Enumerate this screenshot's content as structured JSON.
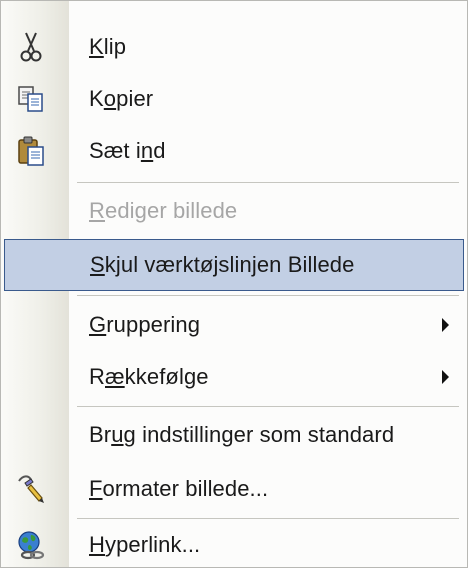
{
  "menu": {
    "items": [
      {
        "pre": "",
        "key": "K",
        "post": "lip",
        "icon": "scissors-icon"
      },
      {
        "pre": "K",
        "key": "o",
        "post": "pier",
        "icon": "copy-icon"
      },
      {
        "pre": "Sæt i",
        "key": "n",
        "post": "d",
        "icon": "clipboard-paste-icon"
      },
      {
        "pre": "",
        "key": "R",
        "post": "ediger billede",
        "disabled": true
      },
      {
        "pre": "",
        "key": "S",
        "post": "kjul værktøjslinjen Billede",
        "highlighted": true
      },
      {
        "pre": "",
        "key": "G",
        "post": "ruppering",
        "submenu": true
      },
      {
        "pre": "R",
        "key": "æ",
        "post": "kkefølge",
        "submenu": true
      },
      {
        "pre": "Br",
        "key": "u",
        "post": "g indstillinger som standard"
      },
      {
        "pre": "",
        "key": "F",
        "post": "ormater billede...",
        "icon": "format-picture-icon"
      },
      {
        "pre": "",
        "key": "H",
        "post": "yperlink...",
        "icon": "hyperlink-globe-icon"
      }
    ]
  },
  "colors": {
    "highlight_fill": "#c2cfe4",
    "highlight_border": "#3a5a8c",
    "disabled_text": "#a6a6a6"
  }
}
